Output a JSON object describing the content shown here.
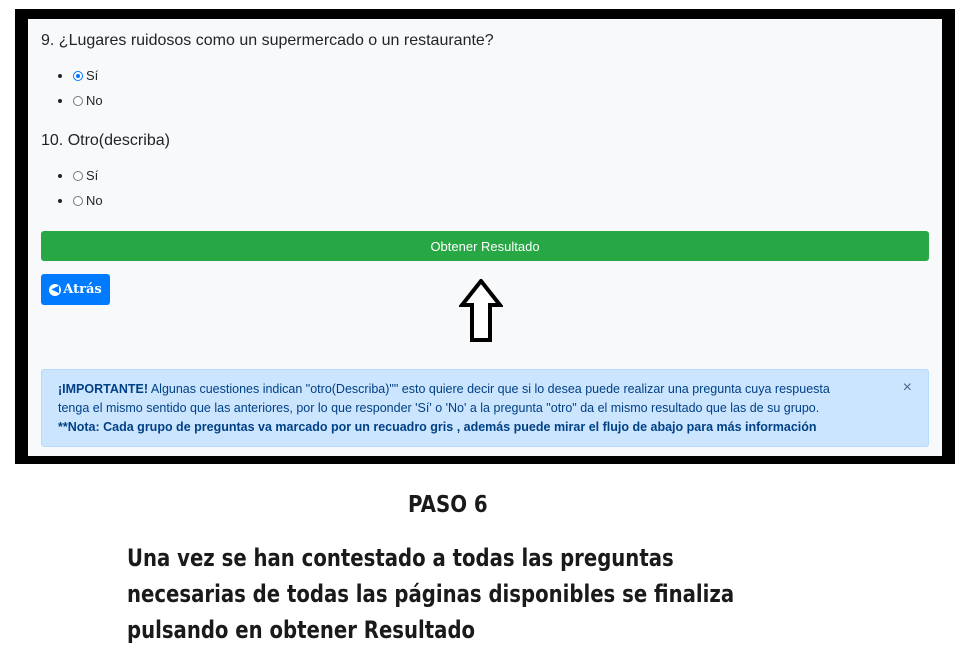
{
  "form": {
    "q9": {
      "text": "9. ¿Lugares ruidosos como un supermercado o un restaurante?",
      "options": [
        {
          "label": "Sí",
          "checked": true
        },
        {
          "label": "No",
          "checked": false
        }
      ]
    },
    "q10": {
      "text": "10. Otro(describa)",
      "options": [
        {
          "label": "Sí",
          "checked": false
        },
        {
          "label": "No",
          "checked": false
        }
      ]
    },
    "submit_label": "Obtener Resultado",
    "back_label": "Atrás"
  },
  "alert": {
    "strong": "¡IMPORTANTE!",
    "text1": " Algunas cuestiones indican \"otro(Describa)\"\" esto quiere decir que si lo desea puede realizar una pregunta cuya respuesta",
    "text2": "tenga el mismo sentido que las anteriores, por lo que responder 'Sí' o 'No' a la pregunta \"otro\" da el mismo resultado que las de su grupo.",
    "note": "**Nota: Cada grupo de preguntas va marcado por un recuadro gris , además puede mirar el flujo de abajo para más información",
    "close": "×"
  },
  "caption": {
    "step": "PASO 6",
    "line1": "Una vez se han contestado a todas las preguntas",
    "line2": "necesarias de todas las páginas disponibles se finaliza",
    "line3": "pulsando en obtener Resultado"
  },
  "colors": {
    "success": "#28a745",
    "primary": "#007bff",
    "alert_bg": "#cce5ff"
  }
}
